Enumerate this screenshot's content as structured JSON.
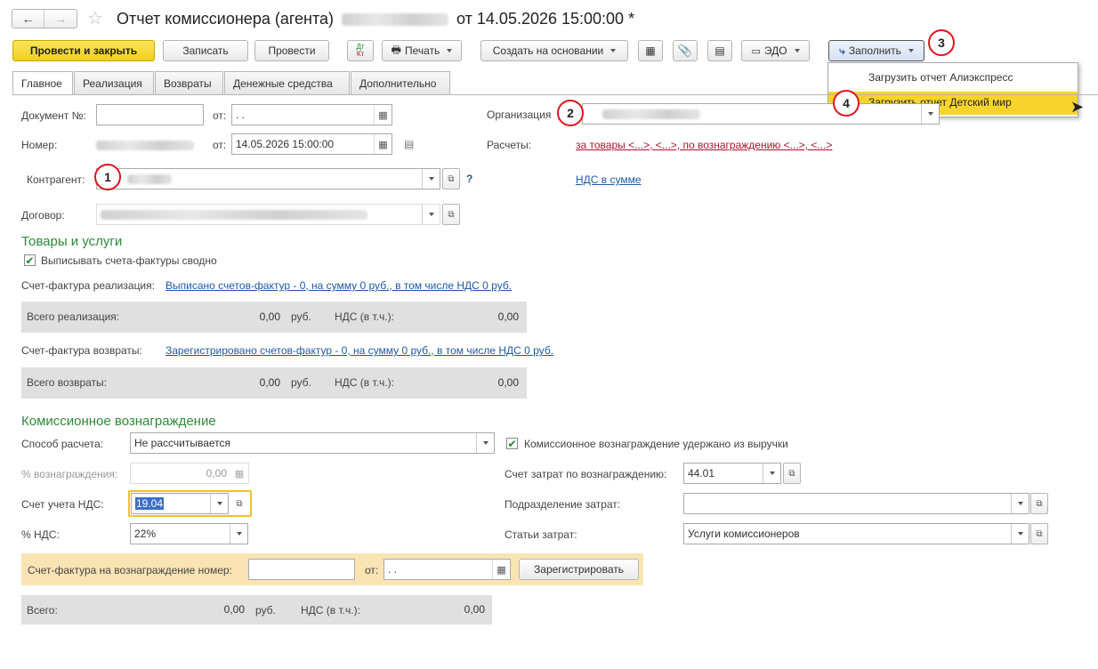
{
  "window": {
    "title": "Отчет комиссионера (агента)",
    "title_suffix": "от 14.05.2026 15:00:00 *"
  },
  "toolbar": {
    "post_close": "Провести и закрыть",
    "save": "Записать",
    "post": "Провести",
    "dtkt_top": "Дт",
    "dtkt_bottom": "Кт",
    "print": "Печать",
    "create_based": "Создать на основании",
    "edo": "ЭДО",
    "fill": "Заполнить"
  },
  "fill_menu": {
    "items": [
      "Загрузить отчет Алиэкспресс",
      "Загрузить отчет Детский мир"
    ]
  },
  "tabs": [
    "Главное",
    "Реализация",
    "Возвраты",
    "Денежные средства",
    "Дополнительно"
  ],
  "header": {
    "doc_no_label": "Документ №:",
    "from_label": "от:",
    "doc_date": " .  .",
    "number_label": "Номер:",
    "number_date": "14.05.2026 15:00:00",
    "org_label": "Организация",
    "settlements_label": "Расчеты:",
    "settlements_link": "за товары <...>, <...>, по вознаграждению <...>, <...>",
    "contractor_label": "Контрагент:",
    "vat_link": "НДС в сумме",
    "help": "?",
    "contract_label": "Договор:"
  },
  "goods": {
    "title": "Товары и услуги",
    "invoice_summary_label": "Выписывать счета-фактуры сводно",
    "invoice_sale_label": "Счет-фактура реализация:",
    "invoice_sale_link": "Выписано счетов-фактур - 0, на сумму 0 руб., в том числе НДС 0 руб.",
    "total_sale_label": "Всего реализация:",
    "total_sale_value": "0,00",
    "currency": "руб.",
    "vat_incl_label": "НДС (в т.ч.):",
    "vat_sale_value": "0,00",
    "invoice_return_label": "Счет-фактура возвраты:",
    "invoice_return_link": "Зарегистрировано счетов-фактур - 0, на сумму 0 руб., в том числе НДС 0 руб.",
    "total_return_label": "Всего возвраты:",
    "total_return_value": "0,00",
    "vat_return_value": "0,00"
  },
  "commission": {
    "title": "Комиссионное вознаграждение",
    "method_label": "Способ расчета:",
    "method_value": "Не рассчитывается",
    "withheld_label": "Комиссионное вознаграждение удержано из выручки",
    "percent_label": "% вознаграждения:",
    "percent_value": "0,00",
    "cost_account_label": "Счет затрат по вознаграждению:",
    "cost_account_value": "44.01",
    "vat_account_label": "Счет учета НДС:",
    "vat_account_value": "19.04",
    "cost_dept_label": "Подразделение затрат:",
    "cost_dept_value": "",
    "vat_rate_label": "% НДС:",
    "vat_rate_value": "22%",
    "cost_item_label": "Статьи затрат:",
    "cost_item_value": "Услуги комиссионеров",
    "invoice_no_label": "Счет-фактура на вознаграждение номер:",
    "invoice_from_label": "от:",
    "invoice_date": " .  .",
    "register_button": "Зарегистрировать",
    "total_label": "Всего:",
    "total_value": "0,00",
    "currency": "руб.",
    "vat_incl_label": "НДС (в т.ч.):",
    "vat_value": "0,00"
  },
  "markers": [
    "1",
    "2",
    "3",
    "4"
  ],
  "colors": {
    "accent_yellow": "#f2cf1e",
    "section_green": "#2e8a3a",
    "marker_red": "#e0141e",
    "link_blue": "#1f5aa8",
    "link_red": "#b3122c"
  }
}
